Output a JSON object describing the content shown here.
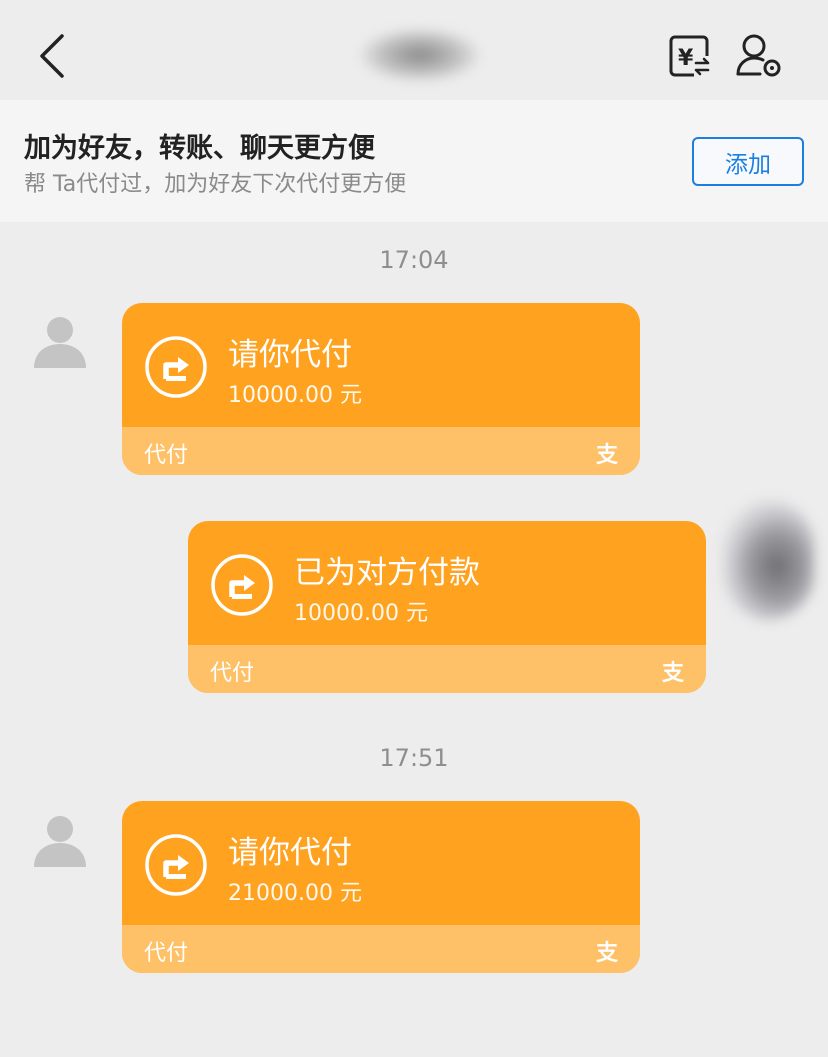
{
  "header": {
    "back_icon": "chevron-left-icon",
    "transfer_icon": "yuan-transfer-icon",
    "profile_icon": "user-settings-icon"
  },
  "banner": {
    "title": "加为好友，转账、聊天更方便",
    "subtitle": "帮 Ta代付过，加为好友下次代付更方便",
    "add_button": "添加"
  },
  "messages": [
    {
      "time": "17:04",
      "side": "left",
      "title": "请你代付",
      "amount": "10000.00 元",
      "label": "代付",
      "logo": "支"
    },
    {
      "time": "",
      "side": "right",
      "title": "已为对方付款",
      "amount": "10000.00 元",
      "label": "代付",
      "logo": "支"
    },
    {
      "time": "17:51",
      "side": "left",
      "title": "请你代付",
      "amount": "21000.00 元",
      "label": "代付",
      "logo": "支"
    }
  ],
  "colors": {
    "card_orange": "#fea21f",
    "card_footer": "#fec167",
    "accent_blue": "#1a7fe0"
  }
}
